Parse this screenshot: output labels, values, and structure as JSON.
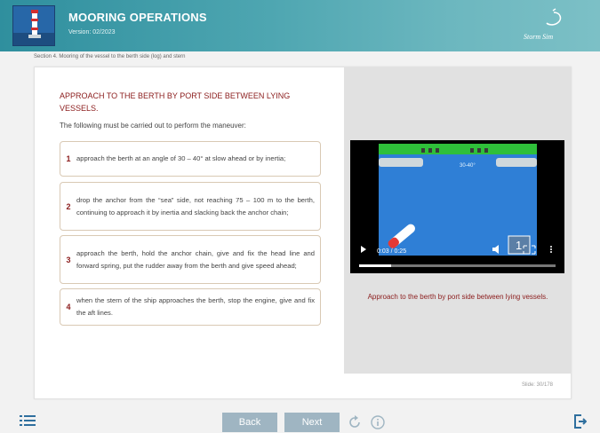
{
  "header": {
    "title": "MOORING OPERATIONS",
    "version": "Version: 02/2023",
    "brand": "Storm Sim"
  },
  "section": "Section 4. Mooring of the vessel to the berth side (log) and stern",
  "content": {
    "title": "APPROACH TO THE BERTH BY PORT SIDE BETWEEN LYING VESSELS.",
    "intro": "The following must be carried out to perform the maneuver:",
    "steps": [
      {
        "num": "1",
        "text": "approach the berth at an angle of 30 – 40° at slow ahead or by inertia;"
      },
      {
        "num": "2",
        "text": "drop the anchor from the “sea” side, not reaching 75 – 100 m to the berth, continuing to approach it by inertia and slacking back the anchor chain;"
      },
      {
        "num": "3",
        "text": "approach the berth, hold the anchor chain, give and fix the head line and forward spring, put the rudder away from the berth and give speed ahead;"
      },
      {
        "num": "4",
        "text": "when the stern of the ship approaches the berth, stop the engine, give and fix the aft lines."
      }
    ]
  },
  "video": {
    "time": "0:03 / 0:25",
    "angle_label": "30-40°",
    "badge": "1",
    "caption": "Approach to the berth by port side between lying vessels."
  },
  "slide": "Slide: 30/178",
  "footer": {
    "back": "Back",
    "next": "Next"
  },
  "colors": {
    "header": "#4ea6b1",
    "accent": "#8b1c1c",
    "button": "#9fb5c2"
  }
}
